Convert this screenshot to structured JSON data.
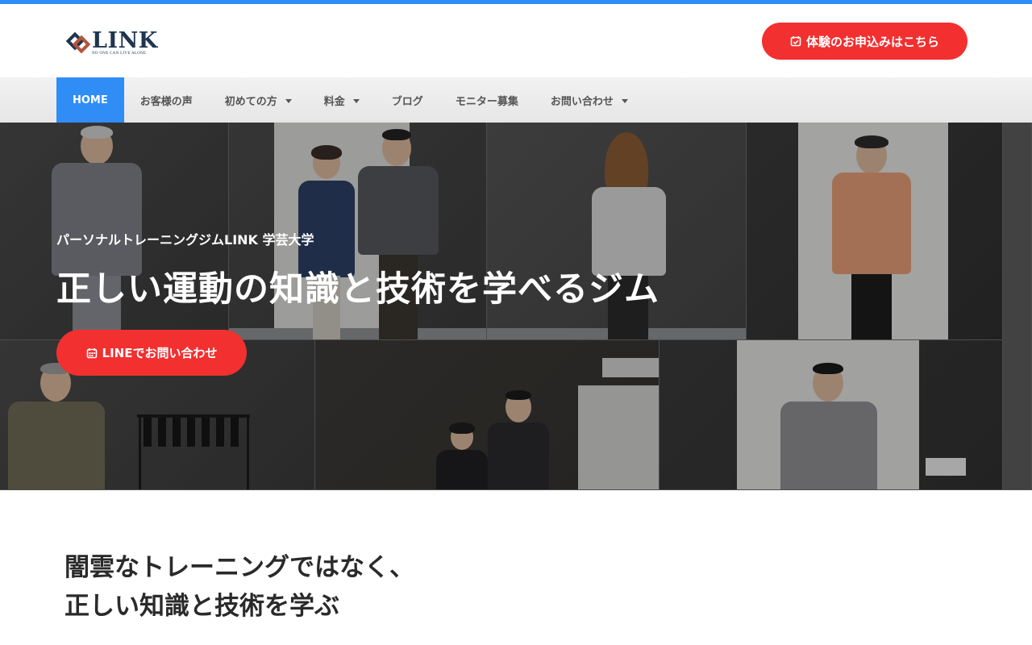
{
  "brand": {
    "logo_text": "LINK",
    "logo_tagline": "NO ONE CAN LIVE ALONE",
    "accent_blue": "#2f8df5",
    "cta_red": "#f23030"
  },
  "header": {
    "cta_label": "体験のお申込みはこちら",
    "cta_icon": "calendar-check-icon"
  },
  "nav": {
    "items": [
      {
        "label": "HOME",
        "active": true,
        "dropdown": false
      },
      {
        "label": "お客様の声",
        "active": false,
        "dropdown": false
      },
      {
        "label": "初めての方",
        "active": false,
        "dropdown": true
      },
      {
        "label": "料金",
        "active": false,
        "dropdown": true
      },
      {
        "label": "ブログ",
        "active": false,
        "dropdown": false
      },
      {
        "label": "モニター募集",
        "active": false,
        "dropdown": false
      },
      {
        "label": "お問い合わせ",
        "active": false,
        "dropdown": true
      }
    ]
  },
  "hero": {
    "subtitle": "パーソナルトレーニングジムLINK 学芸大学",
    "title": "正しい運動の知識と技術を学べるジム",
    "cta_label": "LINEでお問い合わせ",
    "cta_icon": "calendar-icon"
  },
  "intro": {
    "heading_line1": "闇雲なトレーニングではなく、",
    "heading_line2": "正しい知識と技術を学ぶ"
  }
}
